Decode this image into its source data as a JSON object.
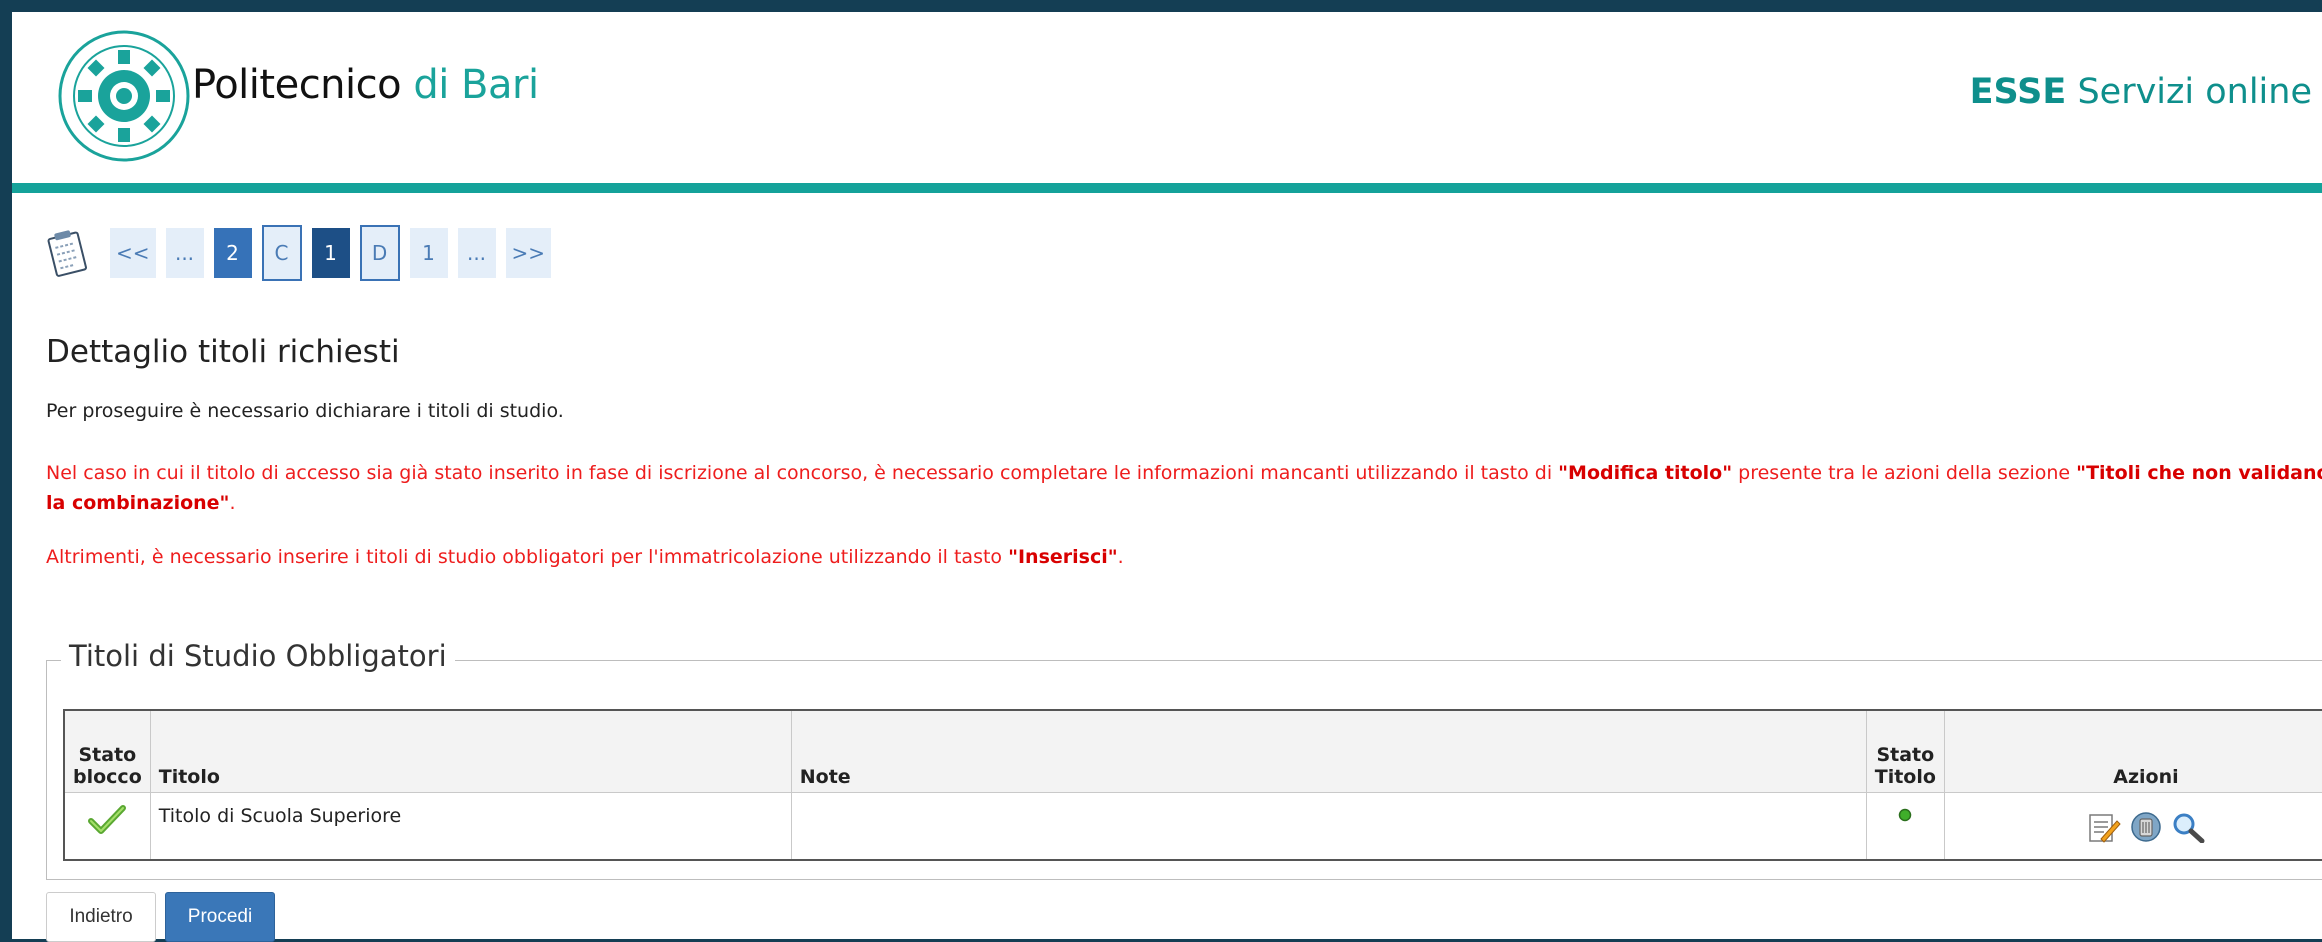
{
  "header": {
    "brand_main": "Politecnico",
    "brand_accent": "di Bari",
    "esse_bold": "ESSE",
    "esse_rest": "Servizi online"
  },
  "pager": {
    "items": [
      "<<",
      "...",
      "2",
      "C",
      "1",
      "D",
      "1",
      "...",
      ">>"
    ]
  },
  "content": {
    "title": "Dettaglio titoli richiesti",
    "intro": "Per proseguire è necessario dichiarare i titoli di studio.",
    "note1_a": "Nel caso in cui il titolo di accesso sia già stato inserito in fase di iscrizione al concorso, è necessario completare le informazioni mancanti utilizzando il tasto di ",
    "note1_b": "\"Modifica titolo\"",
    "note1_c": " presente tra le azioni della sezione ",
    "note1_d": "\"Titoli che non validano la combinazione\"",
    "note1_e": ".",
    "note2_a": "Altrimenti, è necessario inserire i titoli di studio obbligatori per l'immatricolazione utilizzando il tasto ",
    "note2_b": "\"Inserisci\"",
    "note2_c": "."
  },
  "section": {
    "legend": "Titoli di Studio Obbligatori",
    "columns": {
      "stato_blocco_1": "Stato",
      "stato_blocco_2": "blocco",
      "titolo": "Titolo",
      "note": "Note",
      "stato_titolo_1": "Stato",
      "stato_titolo_2": "Titolo",
      "azioni": "Azioni"
    },
    "rows": [
      {
        "titolo": "Titolo di Scuola Superiore",
        "note": ""
      }
    ]
  },
  "buttons": {
    "back": "Indietro",
    "next": "Procedi"
  },
  "colors": {
    "accent_teal": "#14a29a",
    "link_blue": "#3a77b8",
    "warning_red": "#ee1d1d"
  }
}
